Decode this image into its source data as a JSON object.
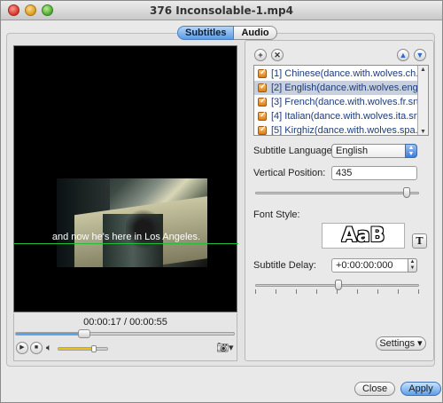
{
  "window": {
    "title": "376 Inconsolable-1.mp4"
  },
  "tabs": [
    {
      "label": "Subtitles",
      "active": true
    },
    {
      "label": "Audio",
      "active": false
    }
  ],
  "player": {
    "subtitle_text": "and now he's here in Los Angeles.",
    "time_readout": "00:00:17 / 00:00:55",
    "progress_fraction": 0.31,
    "volume_fraction": 0.7,
    "icons": {
      "play": "play-icon",
      "stop": "stop-icon",
      "volume": "speaker-icon",
      "snapshot": "camera-icon"
    }
  },
  "subtitle_list": {
    "items": [
      {
        "label": "[1] Chinese(dance.with.wolves.ch...",
        "checked": true,
        "selected": false
      },
      {
        "label": "[2] English(dance.with.wolves.eng...",
        "checked": true,
        "selected": true
      },
      {
        "label": "[3] French(dance.with.wolves.fr.srt)",
        "checked": true,
        "selected": false
      },
      {
        "label": "[4] Italian(dance.with.wolves.ita.srt)",
        "checked": true,
        "selected": false
      },
      {
        "label": "[5] Kirghiz(dance.with.wolves.spa....",
        "checked": true,
        "selected": false
      }
    ]
  },
  "settings": {
    "subtitle_language_label": "Subtitle Language:",
    "subtitle_language_value": "English",
    "vertical_position_label": "Vertical Position:",
    "vertical_position_value": "435",
    "vertical_position_fraction": 0.92,
    "font_style_label": "Font Style:",
    "font_preview": "AaB",
    "font_button": "T",
    "subtitle_delay_label": "Subtitle Delay:",
    "subtitle_delay_value": "+0:00:00:000",
    "subtitle_delay_fraction": 0.5,
    "settings_button": "Settings"
  },
  "buttons": {
    "close": "Close",
    "apply": "Apply"
  },
  "colors": {
    "accent": "#5a9be6",
    "volume": "#e8c21a",
    "subtitle_line": "#1fbf3a"
  }
}
